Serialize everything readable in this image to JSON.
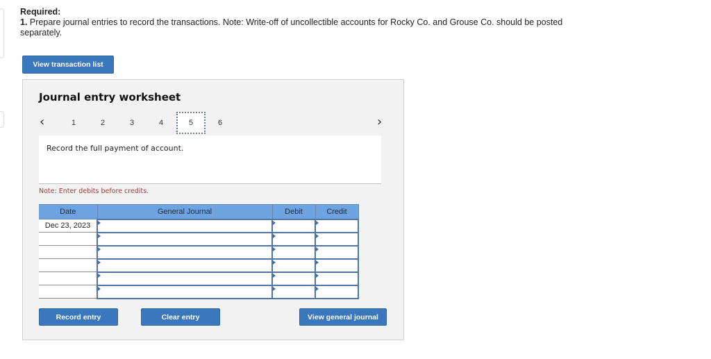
{
  "instructions": {
    "title": "Required:",
    "item_number": "1.",
    "text": "Prepare journal entries to record the transactions. Note: Write-off of uncollectible accounts for Rocky Co. and Grouse Co. should be posted separately."
  },
  "buttons": {
    "view_transaction_list": "View transaction list",
    "record_entry": "Record entry",
    "clear_entry": "Clear entry",
    "view_general_journal": "View general journal"
  },
  "worksheet": {
    "title": "Journal entry worksheet",
    "nav": {
      "prev_icon": "‹",
      "next_icon": "›",
      "tabs": [
        "1",
        "2",
        "3",
        "4",
        "5",
        "6"
      ],
      "active_tab": "5"
    },
    "description": "Record the full payment of account.",
    "note": "Note: Enter debits before credits."
  },
  "journal_table": {
    "headers": {
      "date": "Date",
      "general_journal": "General Journal",
      "debit": "Debit",
      "credit": "Credit"
    },
    "rows": [
      {
        "date": "Dec 23, 2023",
        "account": "",
        "debit": "",
        "credit": ""
      },
      {
        "date": "",
        "account": "",
        "debit": "",
        "credit": ""
      },
      {
        "date": "",
        "account": "",
        "debit": "",
        "credit": ""
      },
      {
        "date": "",
        "account": "",
        "debit": "",
        "credit": ""
      },
      {
        "date": "",
        "account": "",
        "debit": "",
        "credit": ""
      },
      {
        "date": "",
        "account": "",
        "debit": "",
        "credit": ""
      }
    ]
  },
  "colors": {
    "button_blue": "#3a77bd",
    "header_blue": "#6fa3e0",
    "note_red": "#a23a3a",
    "panel_gray": "#f2f2f2"
  }
}
